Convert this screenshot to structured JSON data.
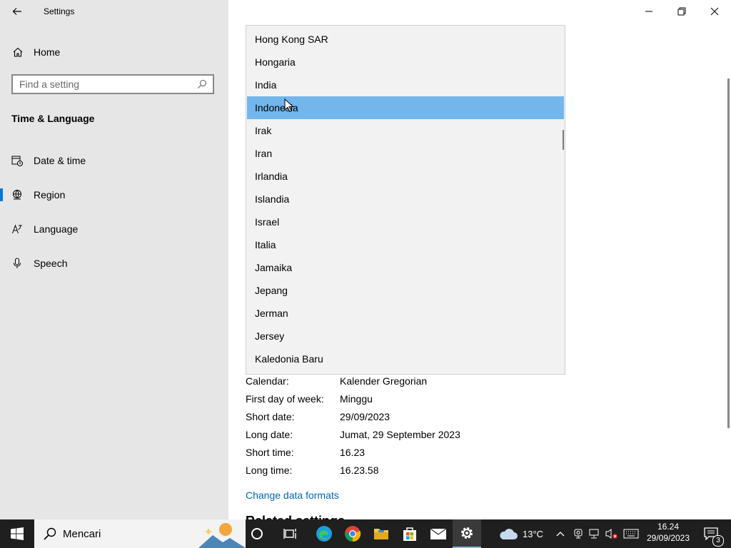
{
  "window": {
    "title": "Settings"
  },
  "sidebar": {
    "home_label": "Home",
    "search_placeholder": "Find a setting",
    "section_title": "Time & Language",
    "items": [
      {
        "label": "Date & time",
        "icon": "calendar-clock-icon"
      },
      {
        "label": "Region",
        "icon": "globe-icon",
        "active": true
      },
      {
        "label": "Language",
        "icon": "language-icon"
      },
      {
        "label": "Speech",
        "icon": "microphone-icon"
      }
    ]
  },
  "dropdown": {
    "options": [
      "Hong Kong SAR",
      "Hongaria",
      "India",
      "Indonesia",
      "Irak",
      "Iran",
      "Irlandia",
      "Islandia",
      "Israel",
      "Italia",
      "Jamaika",
      "Jepang",
      "Jerman",
      "Jersey",
      "Kaledonia Baru"
    ],
    "selected": "Indonesia",
    "selected_color": "#72b6ec"
  },
  "regional_format": {
    "rows": [
      {
        "label": "Calendar:",
        "value": "Kalender Gregorian"
      },
      {
        "label": "First day of week:",
        "value": "Minggu"
      },
      {
        "label": "Short date:",
        "value": "29/09/2023"
      },
      {
        "label": "Long date:",
        "value": "Jumat, 29 September 2023"
      },
      {
        "label": "Short time:",
        "value": "16.23"
      },
      {
        "label": "Long time:",
        "value": "16.23.58"
      }
    ],
    "change_link": "Change data formats",
    "related_heading": "Related settings"
  },
  "taskbar": {
    "search_label": "Mencari",
    "weather": "13°C",
    "time": "16.24",
    "date": "29/09/2023",
    "notification_count": "3",
    "accent": "#0078d7"
  }
}
